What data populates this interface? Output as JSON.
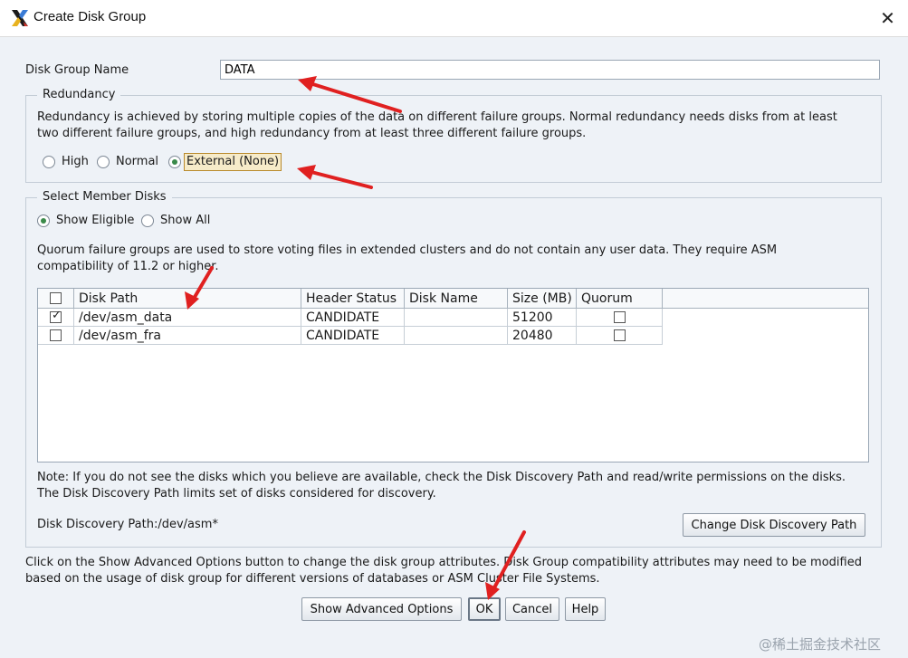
{
  "window": {
    "title": "Create Disk Group",
    "close_glyph": "✕"
  },
  "disk_group_name": {
    "label": "Disk Group Name",
    "value": "DATA"
  },
  "redundancy": {
    "legend": "Redundancy",
    "description_line1": "Redundancy is achieved by storing multiple copies of the data on different failure groups. Normal redundancy needs disks from at least",
    "description_line2": "two different failure groups, and high redundancy from at least three different failure groups.",
    "options": [
      "High",
      "Normal",
      "External (None)"
    ],
    "selected": "External (None)"
  },
  "member_disks": {
    "legend": "Select Member Disks",
    "filter_options": [
      "Show Eligible",
      "Show All"
    ],
    "filter_selected": "Show Eligible",
    "quorum_note_line1": "Quorum failure groups are used to store voting files in extended clusters and do not contain any user data. They require ASM",
    "quorum_note_line2": "compatibility of 11.2 or higher.",
    "table": {
      "columns": [
        "Disk Path",
        "Header Status",
        "Disk Name",
        "Size (MB)",
        "Quorum"
      ],
      "rows": [
        {
          "selected": true,
          "disk_path": "/dev/asm_data",
          "header_status": "CANDIDATE",
          "disk_name": "",
          "size_mb": "51200",
          "quorum": false
        },
        {
          "selected": false,
          "disk_path": "/dev/asm_fra",
          "header_status": "CANDIDATE",
          "disk_name": "",
          "size_mb": "20480",
          "quorum": false
        }
      ]
    },
    "note_line1": "Note: If you do not see the disks which you believe are available, check the Disk Discovery Path and read/write permissions on the disks.",
    "note_line2": "The Disk Discovery Path limits set of disks considered for discovery.",
    "discovery_path": "Disk Discovery Path:/dev/asm*",
    "change_path_button": "Change Disk Discovery Path"
  },
  "advanced_text_line1": "Click on the Show Advanced Options button to change the disk group attributes. Disk Group compatibility attributes may need to be modified",
  "advanced_text_line2": "based on the usage of disk group for different versions of databases or ASM Cluster File Systems.",
  "buttons": {
    "show_advanced": "Show Advanced Options",
    "ok": "OK",
    "cancel": "Cancel",
    "help": "Help"
  },
  "watermark": "@稀土掘金技术社区",
  "colors": {
    "annotation_arrow": "#e02020",
    "radio_selected": "#3a8a4a"
  }
}
